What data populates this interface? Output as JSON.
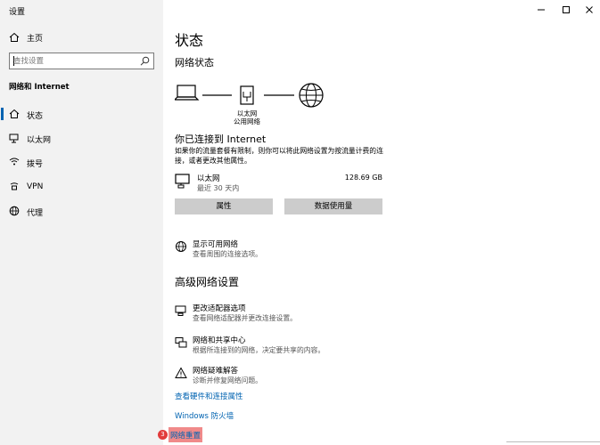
{
  "window": {
    "title": "设置",
    "minimize_glyph": "—",
    "maximize_glyph": "☐",
    "close_glyph": "✕"
  },
  "sidebar": {
    "home_label": "主页",
    "search_placeholder": "查找设置",
    "section_label": "网络和 Internet",
    "items": [
      {
        "label": "状态",
        "icon": "home-status-icon",
        "selected": true
      },
      {
        "label": "以太网",
        "icon": "ethernet-icon",
        "selected": false
      },
      {
        "label": "拨号",
        "icon": "dialup-icon",
        "selected": false
      },
      {
        "label": "VPN",
        "icon": "vpn-icon",
        "selected": false
      },
      {
        "label": "代理",
        "icon": "globe-icon",
        "selected": false
      }
    ]
  },
  "main": {
    "title": "状态",
    "network_status": "网络状态",
    "diagram": {
      "label_line1": "以太网",
      "label_line2": "公用网络"
    },
    "connected_title": "你已连接到 Internet",
    "connected_desc": "如果你的流量套餐有限制，则你可以将此网络设置为按流量计费的连接，或者更改其他属性。",
    "ethernet": {
      "name": "以太网",
      "time": "最近 30 天内",
      "size": "128.69 GB"
    },
    "buttons": {
      "properties": "属性",
      "data_usage": "数据使用量"
    },
    "show_networks": {
      "title": "显示可用网络",
      "desc": "查看周围的连接选项。"
    },
    "advanced_title": "高级网络设置",
    "advanced": [
      {
        "title": "更改适配器选项",
        "desc": "查看网络适配器并更改连接设置。"
      },
      {
        "title": "网络和共享中心",
        "desc": "根据所连接到的网络，决定要共享的内容。"
      },
      {
        "title": "网络疑难解答",
        "desc": "诊断并修复网络问题。"
      }
    ],
    "links": {
      "hardware": "查看硬件和连接属性",
      "firewall": "Windows 防火墙",
      "reset": "网络重置"
    },
    "reset_badge": "3"
  },
  "colors": {
    "accent": "#0063b1",
    "sidebar_bg": "#f2f2f2",
    "button_bg": "#cccccc",
    "highlight": "#f08a8a",
    "badge": "#e23b3b"
  }
}
